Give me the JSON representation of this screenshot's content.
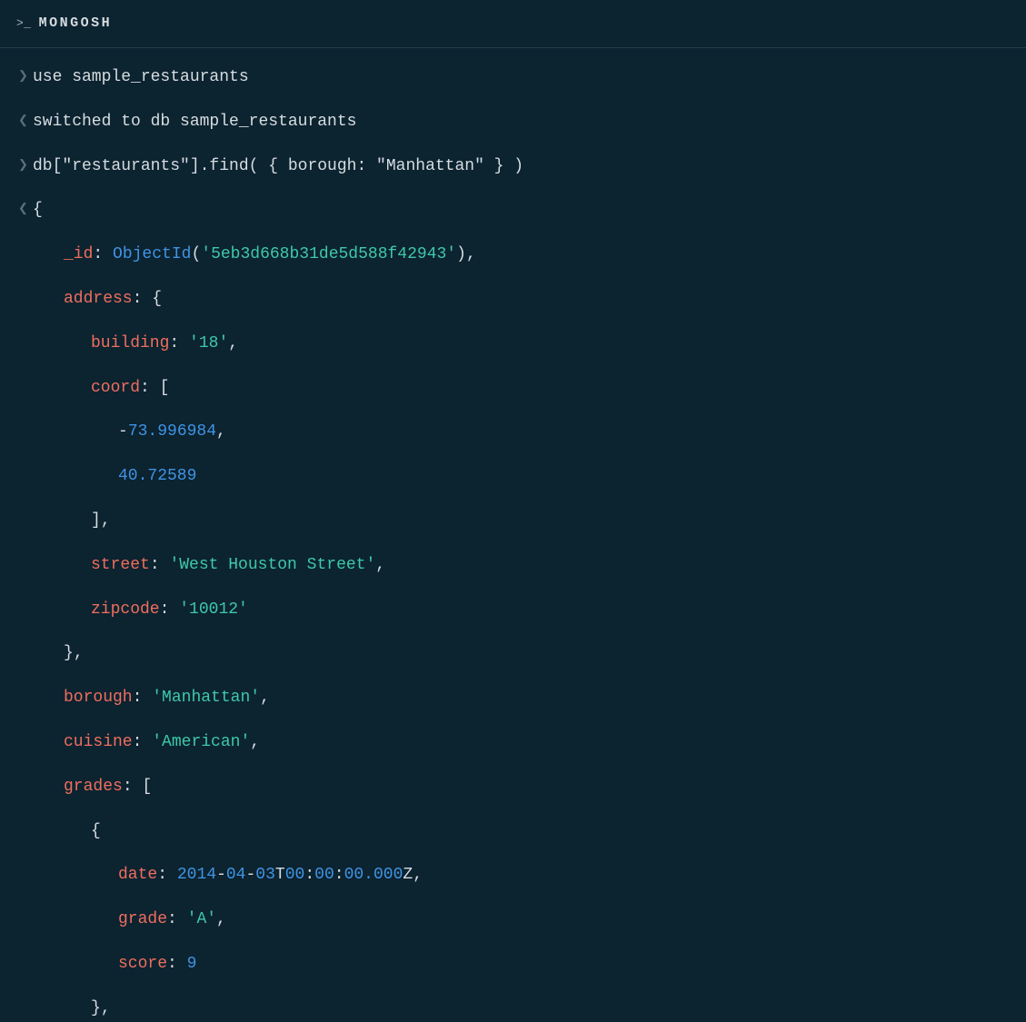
{
  "header": {
    "prompt": ">_",
    "title": "MONGOSH"
  },
  "lines": {
    "cmd1": "use sample_restaurants",
    "out1": "switched to db sample_restaurants",
    "cmd2": "db[\"restaurants\"].find( { borough: \"Manhattan\" } )",
    "brace_open": "{",
    "id_key": "_id",
    "colon": ":",
    "objectid_fn": "ObjectId",
    "lparen": "(",
    "id_val": "'5eb3d668b31de5d588f42943'",
    "rparen": ")",
    "comma": ",",
    "address_key": "address",
    "brace_open2": " {",
    "building_key": "building",
    "building_val": "'18'",
    "coord_key": "coord",
    "bracket_open": " [",
    "coord_neg": "-",
    "coord_0": "73.996984",
    "coord_1": "40.72589",
    "bracket_close": "]",
    "street_key": "street",
    "street_val": "'West Houston Street'",
    "zipcode_key": "zipcode",
    "zipcode_val": "'10012'",
    "brace_close": "}",
    "borough_key": "borough",
    "borough_val": "'Manhattan'",
    "cuisine_key": "cuisine",
    "cuisine_val": "'American'",
    "grades_key": "grades",
    "date_key": "date",
    "date_y": "2014",
    "dash": "-",
    "date_m": "04",
    "date_d": "03",
    "date_t": "T",
    "date_h": "00",
    "date_colon": ":",
    "date_min": "00",
    "date_sec": "00.000",
    "date_z": "Z",
    "grade_key": "grade",
    "grade_val": "'A'",
    "score_key": "score",
    "score_val": "9"
  }
}
